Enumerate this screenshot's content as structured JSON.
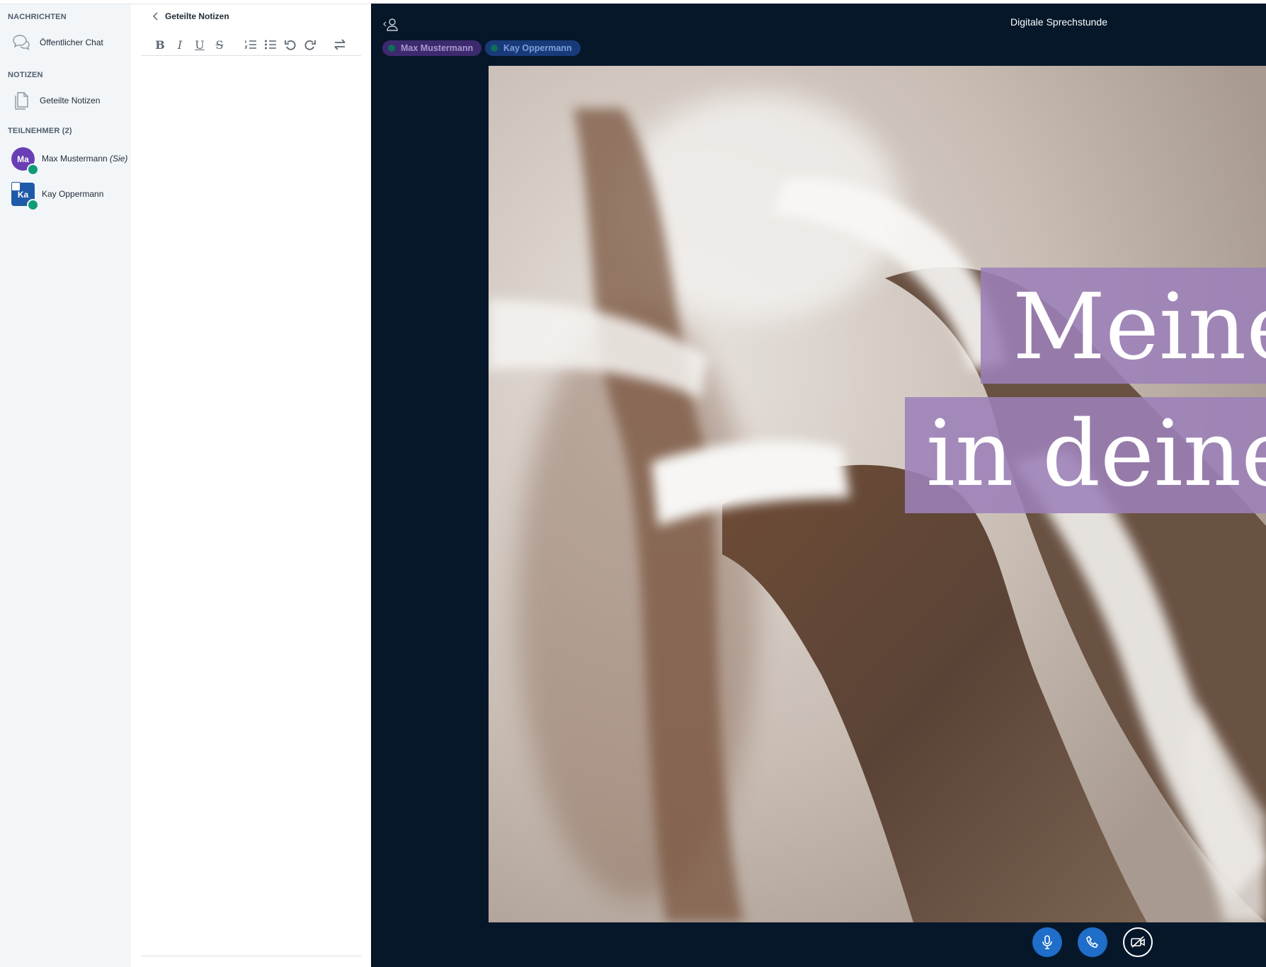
{
  "sidebar": {
    "messages_title": "NACHRICHTEN",
    "public_chat_label": "Öffentlicher Chat",
    "notes_title": "NOTIZEN",
    "shared_notes_label": "Geteilte Notizen",
    "participants_title": "TEILNEHMER (2)",
    "users": [
      {
        "initials": "Ma",
        "name": "Max Mustermann",
        "suffix": "(Sie)",
        "color": "#6a3fb5"
      },
      {
        "initials": "Ka",
        "name": "Kay Oppermann",
        "suffix": "",
        "color": "#1f5aa8"
      }
    ]
  },
  "notes_panel": {
    "back_label": "Geteilte Notizen",
    "toolbar": [
      "B",
      "I",
      "U",
      "S",
      "ordered-list",
      "bullet-list",
      "undo",
      "redo",
      "swap"
    ]
  },
  "main": {
    "title": "Digitale Sprechstunde",
    "talkers": [
      "Max Mustermann",
      "Kay Oppermann"
    ],
    "slide_line1": "Meine",
    "slide_line2": "in deiner",
    "colors": {
      "background": "#06172a",
      "accent": "#1f6ec9",
      "purple_band": "#9c81b8"
    }
  },
  "controls": [
    "microphone-icon",
    "phone-icon",
    "video-off-icon"
  ]
}
